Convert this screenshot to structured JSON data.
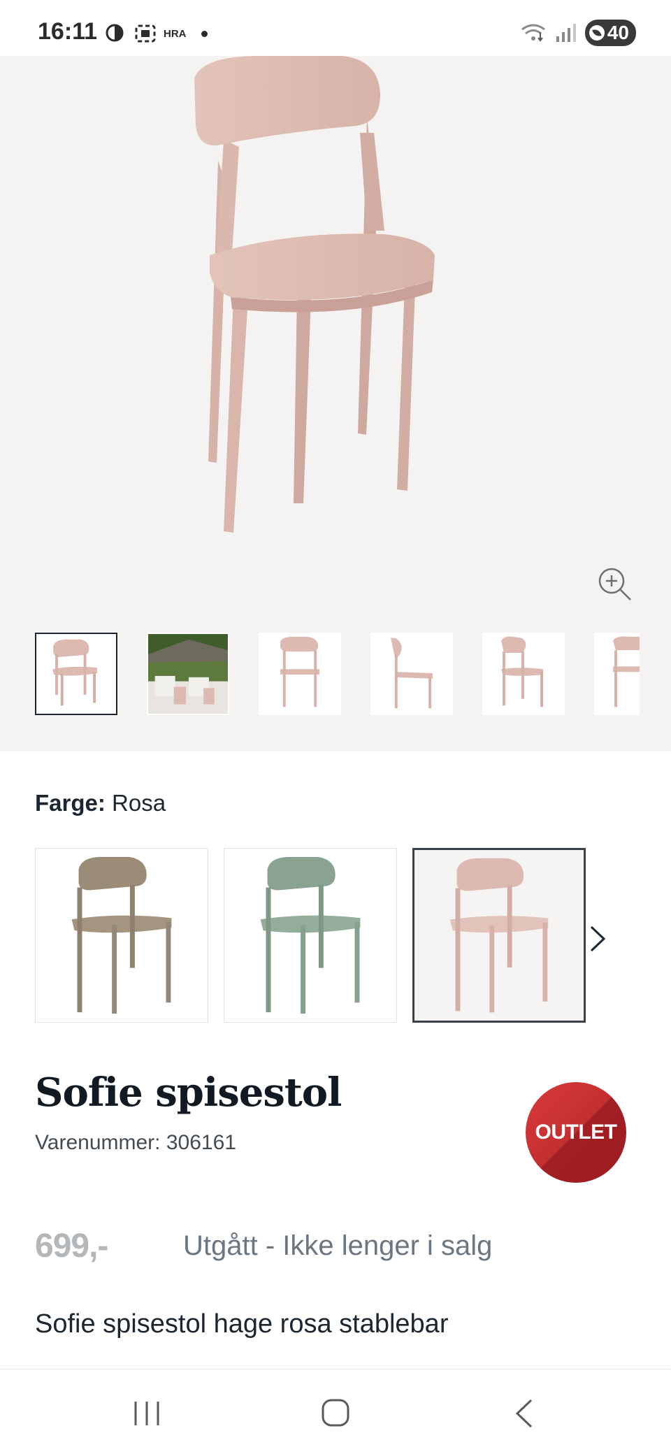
{
  "status_bar": {
    "time": "16:11",
    "icons": [
      "data-saver-icon",
      "screen-record-icon",
      "hra-icon",
      "dot-icon"
    ],
    "hra_label": "HRA",
    "right_icons": [
      "wifi-icon",
      "signal-icon"
    ],
    "battery_level": "40"
  },
  "hero": {
    "image": "pink-chair-photo",
    "zoom_icon": "zoom-in-icon",
    "active_thumbnail": 0,
    "thumbnails": [
      "chair-front",
      "garden-scene",
      "chair-straight",
      "chair-side",
      "chair-angle",
      "chair-partial"
    ]
  },
  "color": {
    "label": "Farge:",
    "value": "Rosa",
    "options": [
      {
        "name": "beige",
        "color": "#9b8c78"
      },
      {
        "name": "green",
        "color": "#8aa390"
      },
      {
        "name": "rosa",
        "color": "#dcbab1"
      }
    ],
    "selected_index": 2
  },
  "product": {
    "title": "Sofie spisestol",
    "sku": "Varenummer: 306161",
    "badge": "OUTLET",
    "price": "699,-",
    "availability": "Utgått - Ikke lenger i salg",
    "description": "Sofie spisestol hage rosa stablebar"
  },
  "nav": {
    "buttons": [
      "recent-apps-icon",
      "home-icon",
      "back-icon"
    ]
  },
  "colors": {
    "accent_red": "#c42f30",
    "text_dark": "#1b2630",
    "price_grey": "#b3b7ba",
    "status_grey": "#6b7680",
    "hero_bg": "#f5f3f1"
  }
}
